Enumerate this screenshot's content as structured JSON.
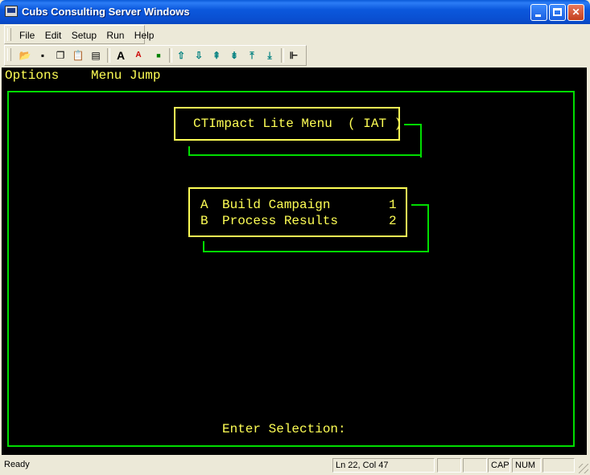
{
  "window": {
    "title": "Cubs Consulting Server Windows"
  },
  "menu": [
    "File",
    "Edit",
    "Setup",
    "Run",
    "Help"
  ],
  "toolbar_icons": [
    "open-folder-icon",
    "save-disk-icon",
    "copy-icon",
    "paste-icon",
    "paste-special-icon",
    "font-large-icon",
    "font-small-icon",
    "dot-icon",
    "arrow-up-icon",
    "arrow-down-icon",
    "page-up-icon",
    "page-down-icon",
    "top-icon",
    "bottom-icon",
    "connect-icon"
  ],
  "terminal": {
    "top_menu": {
      "options": "Options",
      "menu_jump": "Menu Jump"
    },
    "title": "CTImpact Lite Menu  ( IAT )",
    "items": [
      {
        "key": "A",
        "label": "Build Campaign",
        "num": "1"
      },
      {
        "key": "B",
        "label": "Process Results",
        "num": "2"
      }
    ],
    "prompt": "Enter Selection:",
    "colors": {
      "background": "#000000",
      "text": "#ffff55",
      "border": "#00dd00"
    }
  },
  "status": {
    "ready": "Ready",
    "position": "Ln 22, Col 47",
    "cap": "CAP",
    "num": "NUM"
  }
}
